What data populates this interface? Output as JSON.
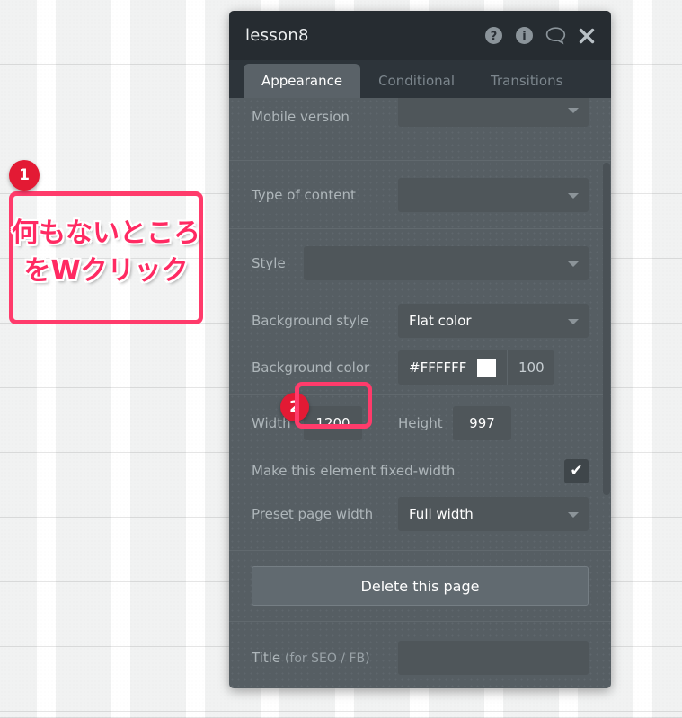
{
  "panel": {
    "title": "lesson8",
    "header_icons": [
      {
        "name": "help-icon",
        "glyph": "?"
      },
      {
        "name": "info-icon",
        "glyph": "i"
      },
      {
        "name": "comment-icon",
        "glyph": "speech-bubble"
      },
      {
        "name": "close-icon",
        "glyph": "✖"
      }
    ],
    "tabs": [
      {
        "label": "Appearance",
        "active": true
      },
      {
        "label": "Conditional",
        "active": false
      },
      {
        "label": "Transitions",
        "active": false
      }
    ],
    "fields": {
      "mobile_version_label": "Mobile version",
      "mobile_version_value": "",
      "type_of_content_label": "Type of content",
      "type_of_content_value": "",
      "style_label": "Style",
      "style_value": "",
      "background_style_label": "Background style",
      "background_style_value": "Flat color",
      "background_color_label": "Background color",
      "background_color_hex": "#FFFFFF",
      "background_color_swatch": "#FFFFFF",
      "background_color_opacity": "100",
      "width_label": "Width",
      "width_value": "1200",
      "height_label": "Height",
      "height_value": "997",
      "fixed_width_label": "Make this element fixed-width",
      "fixed_width_checked": "✔",
      "preset_page_width_label": "Preset page width",
      "preset_page_width_value": "Full width",
      "delete_button_label": "Delete this page",
      "title_seo_label": "Title ",
      "title_seo_sub": "(for SEO / FB)",
      "title_seo_value": ""
    }
  },
  "annotations": {
    "badge_1": "1",
    "badge_2": "2",
    "callout_text": "何もないところ\nをWクリック"
  },
  "colors": {
    "panel_header": "#262c31",
    "panel_body": "#565e63",
    "field": "#4f565a",
    "accent_pink": "#ff3b6b",
    "badge_red": "#e31a34",
    "callout_text": "#ff2a62"
  }
}
